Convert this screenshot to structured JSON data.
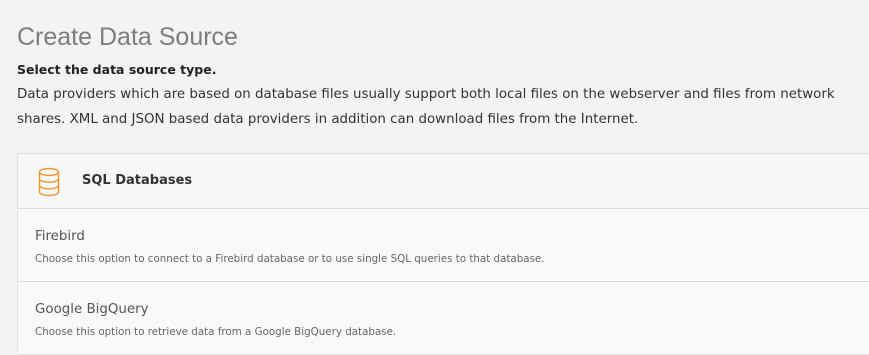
{
  "header": {
    "title": "Create Data Source",
    "subtitle": "Select the data source type.",
    "description": "Data providers which are based on database files usually support both local files on the webserver and files from network shares. XML and JSON based data providers in addition can download files from the Internet."
  },
  "panel": {
    "icon": "database-icon",
    "label": "SQL Databases",
    "accent_color": "#f0932b",
    "options": [
      {
        "title": "Firebird",
        "description": "Choose this option to connect to a Firebird database or to use single SQL queries to that database."
      },
      {
        "title": "Google BigQuery",
        "description": "Choose this option to retrieve data from a Google BigQuery database."
      }
    ]
  }
}
